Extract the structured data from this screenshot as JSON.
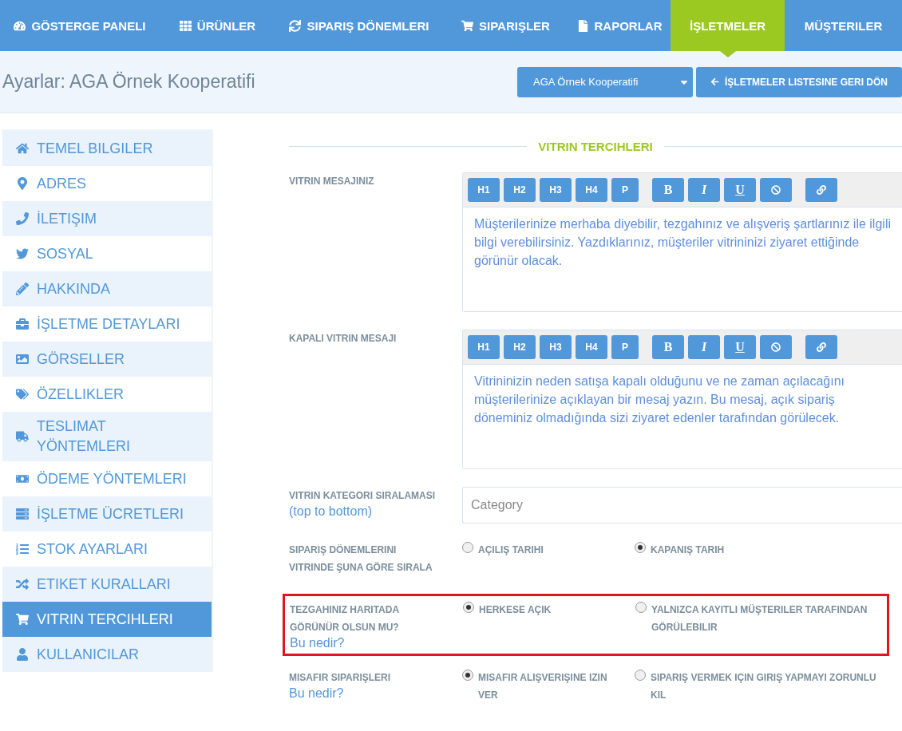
{
  "nav": [
    {
      "label": "GÖSTERGE PANELI",
      "selected": false
    },
    {
      "label": "ÜRÜNLER",
      "selected": false
    },
    {
      "label": "SIPARIŞ DÖNEMLERI",
      "selected": false
    },
    {
      "label": "SIPARIŞLER",
      "selected": false
    },
    {
      "label": "RAPORLAR",
      "selected": false
    },
    {
      "label": "İŞLETMELER",
      "selected": true
    },
    {
      "label": "MÜŞTERILER",
      "selected": false
    }
  ],
  "header": {
    "title": "Ayarlar: AGA Örnek Kooperatifi",
    "business_select": "AGA Örnek Kooperatifi",
    "back_button": "İŞLETMELER LISTESINE GERI DÖN"
  },
  "sidebar": {
    "items": [
      {
        "label": "TEMEL BILGILER",
        "selected": false
      },
      {
        "label": "ADRES",
        "selected": false
      },
      {
        "label": "İLETIŞIM",
        "selected": false
      },
      {
        "label": "SOSYAL",
        "selected": false
      },
      {
        "label": "HAKKINDA",
        "selected": false
      },
      {
        "label": "İŞLETME DETAYLARI",
        "selected": false
      },
      {
        "label": "GÖRSELLER",
        "selected": false
      },
      {
        "label": "ÖZELLIKLER",
        "selected": false
      },
      {
        "label": "TESLIMAT YÖNTEMLERI",
        "selected": false
      },
      {
        "label": "ÖDEME YÖNTEMLERI",
        "selected": false
      },
      {
        "label": "İŞLETME ÜCRETLERI",
        "selected": false
      },
      {
        "label": "STOK AYARLARI",
        "selected": false
      },
      {
        "label": "ETIKET KURALLARI",
        "selected": false
      },
      {
        "label": "VITRIN TERCIHLERI",
        "selected": true
      },
      {
        "label": "KULLANICILAR",
        "selected": false
      }
    ]
  },
  "section_title": "VITRIN TERCIHLERI",
  "rows": [
    {
      "kind": "editor",
      "label": "VITRIN MESAJINIZ",
      "toolbar": [
        "H1",
        "H2",
        "H3",
        "H4",
        "P",
        "B",
        "I",
        "U"
      ],
      "placeholder": "Müşterilerinize merhaba diyebilir, tezgahınız ve alışveriş şartlarınız ile ilgili bilgi verebilirsiniz. Yazdıklarınız, müşteriler vitrininizi ziyaret ettiğinde görünür olacak."
    },
    {
      "kind": "editor",
      "label": "KAPALI VITRIN MESAJI",
      "toolbar": [
        "H1",
        "H2",
        "H3",
        "H4",
        "P",
        "B",
        "I",
        "U"
      ],
      "placeholder": "Vitrininizin neden satışa kapalı olduğunu ve ne zaman açılacağını müşterilerinize açıklayan bir mesaj yazın. Bu mesaj, açık sipariş döneminiz olmadığında sizi ziyaret edenler tarafından görülecek."
    },
    {
      "kind": "select",
      "label": "VITRIN KATEGORI SIRALAMASI",
      "link": "(top to bottom)",
      "placeholder": "Category"
    },
    {
      "kind": "radio",
      "label": "SIPARIŞ DÖNEMLERINI VITRINDE ŞUNA GÖRE SIRALA",
      "highlighted": false,
      "options": [
        {
          "label": "AÇILIŞ TARIHI",
          "selected": false
        },
        {
          "label": "KAPANIŞ TARIH",
          "selected": true
        }
      ]
    },
    {
      "kind": "radio",
      "label": "TEZGAHINIZ HARITADA GÖRÜNÜR OLSUN MU?",
      "link": "Bu nedir?",
      "highlighted": true,
      "options": [
        {
          "label": "HERKESE AÇIK",
          "selected": true
        },
        {
          "label": "YALNIZCA KAYITLI MÜŞTERILER TARAFINDAN GÖRÜLEBILIR",
          "selected": false
        }
      ]
    },
    {
      "kind": "radio",
      "label": "MISAFIR SIPARIŞLERI",
      "link": "Bu nedir?",
      "highlighted": false,
      "options": [
        {
          "label": "MISAFIR ALIŞVERIŞINE IZIN VER",
          "selected": true
        },
        {
          "label": "SIPARIŞ VERMEK IÇIN GIRIŞ YAPMAYI ZORUNLU KIL",
          "selected": false
        }
      ]
    }
  ]
}
